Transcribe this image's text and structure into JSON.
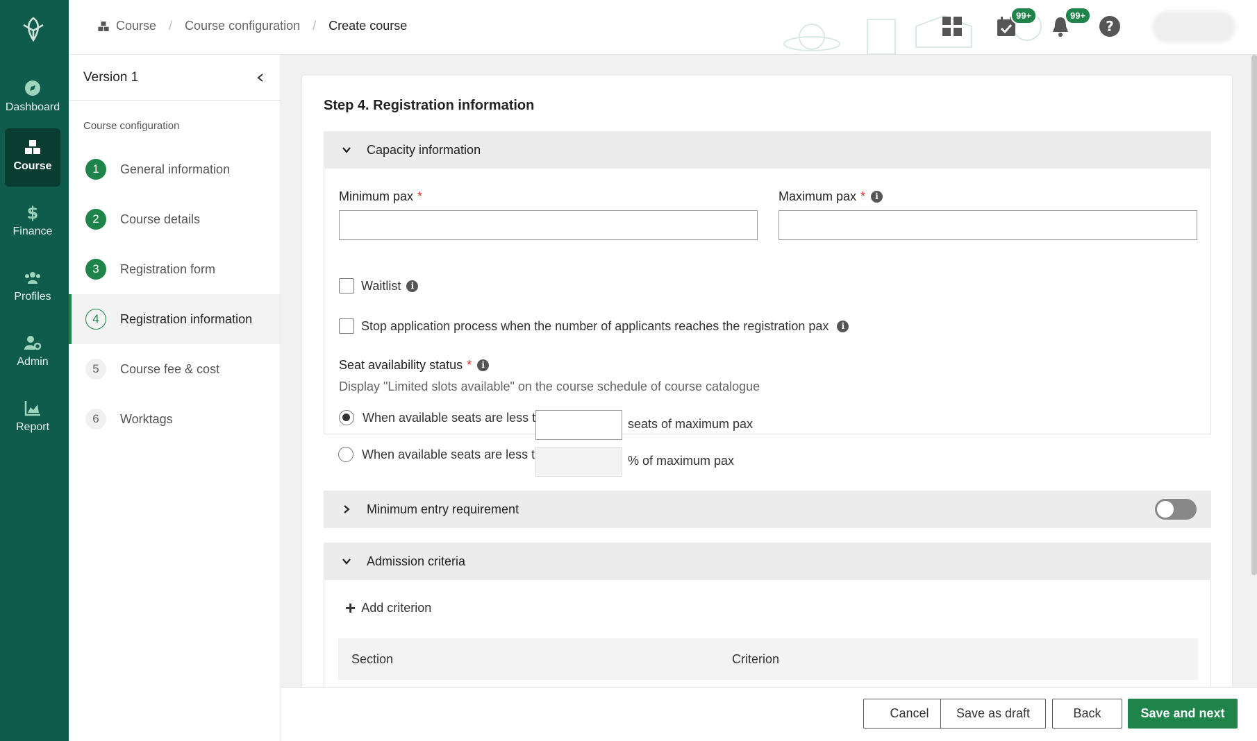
{
  "breadcrumb": [
    "Course",
    "Course configuration",
    "Create course"
  ],
  "topbar": {
    "tasks_badge": "99+",
    "notifications_badge": "99+"
  },
  "leftnav": [
    {
      "label": "Dashboard",
      "icon": "compass-icon"
    },
    {
      "label": "Course",
      "icon": "cubes-icon",
      "active": true
    },
    {
      "label": "Finance",
      "icon": "dollar-icon"
    },
    {
      "label": "Profiles",
      "icon": "users-icon"
    },
    {
      "label": "Admin",
      "icon": "user-gear-icon"
    },
    {
      "label": "Report",
      "icon": "chart-area-icon"
    }
  ],
  "subside": {
    "version": "Version 1",
    "group": "Course configuration",
    "steps": [
      {
        "num": "1",
        "label": "General information",
        "state": "done"
      },
      {
        "num": "2",
        "label": "Course details",
        "state": "done"
      },
      {
        "num": "3",
        "label": "Registration form",
        "state": "done"
      },
      {
        "num": "4",
        "label": "Registration information",
        "state": "current"
      },
      {
        "num": "5",
        "label": "Course fee & cost",
        "state": "todo"
      },
      {
        "num": "6",
        "label": "Worktags",
        "state": "todo"
      }
    ]
  },
  "main": {
    "title": "Step 4. Registration information",
    "capacity": {
      "header": "Capacity information",
      "min_label": "Minimum pax",
      "max_label": "Maximum pax",
      "min_value": "",
      "max_value": "",
      "waitlist_label": "Waitlist",
      "stop_label": "Stop application process when the number of applicants reaches the registration pax",
      "seat_label": "Seat availability status",
      "seat_hint": "Display \"Limited slots available\" on the course schedule of course catalogue",
      "opt1_prefix": "When available seats are less than",
      "opt1_suffix": "seats of maximum pax",
      "opt2_prefix": "When available seats are less than",
      "opt2_suffix": "% of maximum pax",
      "selected_option": 1
    },
    "min_entry": {
      "header": "Minimum entry requirement",
      "enabled": false
    },
    "admission": {
      "header": "Admission criteria",
      "add_label": "Add criterion",
      "columns": [
        "Section",
        "Criterion"
      ]
    }
  },
  "footer": {
    "cancel": "Cancel",
    "draft": "Save as draft",
    "back": "Back",
    "next": "Save and next"
  },
  "colors": {
    "nav_bg": "#0f5c4c",
    "accent": "#1e8449",
    "required": "#d9342b"
  }
}
